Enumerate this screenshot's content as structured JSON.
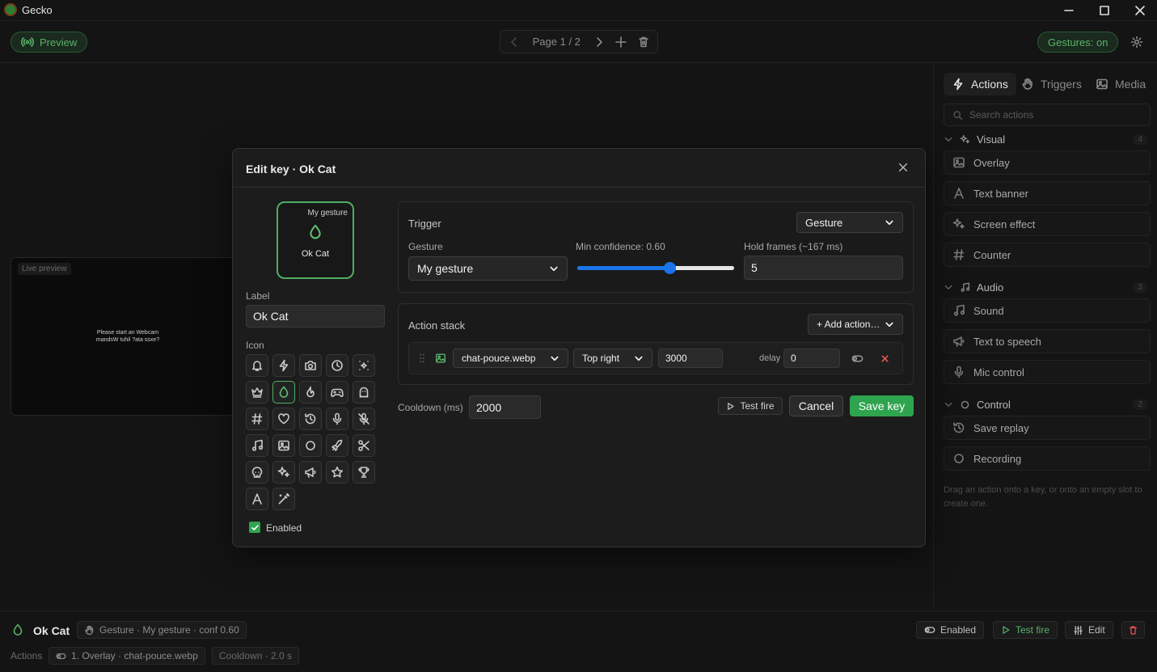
{
  "window": {
    "title": "Gecko"
  },
  "toolbar": {
    "preview_label": "Preview",
    "page_label": "Page 1 / 2",
    "gestures_label": "Gestures: on"
  },
  "preview": {
    "tag": "Live preview",
    "message_line1": "Please start an Webcam",
    "message_line2": "mandsW tuhil ?ata ssxe?"
  },
  "panel": {
    "tabs": [
      {
        "label": "Actions"
      },
      {
        "label": "Triggers"
      },
      {
        "label": "Media"
      }
    ],
    "search_placeholder": "Search actions",
    "sections": [
      {
        "title": "Visual",
        "count": "4",
        "items": [
          {
            "label": "Overlay"
          },
          {
            "label": "Text banner"
          },
          {
            "label": "Screen effect"
          },
          {
            "label": "Counter"
          }
        ]
      },
      {
        "title": "Audio",
        "count": "3",
        "items": [
          {
            "label": "Sound"
          },
          {
            "label": "Text to speech"
          },
          {
            "label": "Mic control"
          }
        ]
      },
      {
        "title": "Control",
        "count": "2",
        "items": [
          {
            "label": "Save replay"
          },
          {
            "label": "Recording"
          }
        ]
      }
    ],
    "hint": "Drag an action onto a key, or onto an empty slot to create one."
  },
  "modal": {
    "title": "Edit key · Ok Cat",
    "key_preview": {
      "subtitle": "My gesture",
      "label": "Ok Cat"
    },
    "label_field": {
      "label": "Label",
      "value": "Ok Cat"
    },
    "icon_label": "Icon",
    "icons": [
      "bell-icon",
      "bolt-icon",
      "camera-icon",
      "clock-icon",
      "sparkle-scatter-icon",
      "crown-icon",
      "droplet-icon",
      "flame-icon",
      "gamepad-icon",
      "ghost-icon",
      "hash-icon",
      "heart-icon",
      "history-icon",
      "mic-icon",
      "mic-off-icon",
      "music-icon",
      "image-icon",
      "circle-icon",
      "rocket-icon",
      "scissors-icon",
      "skull-icon",
      "sparkles-icon",
      "megaphone-icon",
      "star-icon",
      "trophy-icon",
      "text-a-icon",
      "magic-wand-icon"
    ],
    "selected_icon": "droplet-icon",
    "enabled_label": "Enabled",
    "trigger": {
      "title": "Trigger",
      "type": "Gesture",
      "gesture_label": "Gesture",
      "gesture_value": "My gesture",
      "confidence_label": "Min confidence: 0.60",
      "confidence_value": 0.6,
      "hold_label": "Hold frames (~167 ms)",
      "hold_value": "5"
    },
    "action_stack": {
      "title": "Action stack",
      "add_label": "+ Add action…",
      "rows": [
        {
          "file": "chat-pouce.webp",
          "position": "Top right",
          "duration": "3000",
          "delay_label": "delay",
          "delay": "0"
        }
      ]
    },
    "cooldown": {
      "label": "Cooldown (ms)",
      "value": "2000"
    },
    "test_label": "Test fire",
    "cancel_label": "Cancel",
    "save_label": "Save key"
  },
  "bottom": {
    "key_name": "Ok Cat",
    "trigger_chip": "Gesture · My gesture · conf 0.60",
    "actions_label": "Actions",
    "action_chip": "1. Overlay · chat-pouce.webp",
    "cooldown_chip": "Cooldown · 2.0 s",
    "enabled_label": "Enabled",
    "test_label": "Test fire",
    "edit_label": "Edit"
  },
  "colors": {
    "accent": "#2fa44f",
    "accent_text": "#59b36a",
    "danger": "#e05555",
    "background": "#141414"
  }
}
